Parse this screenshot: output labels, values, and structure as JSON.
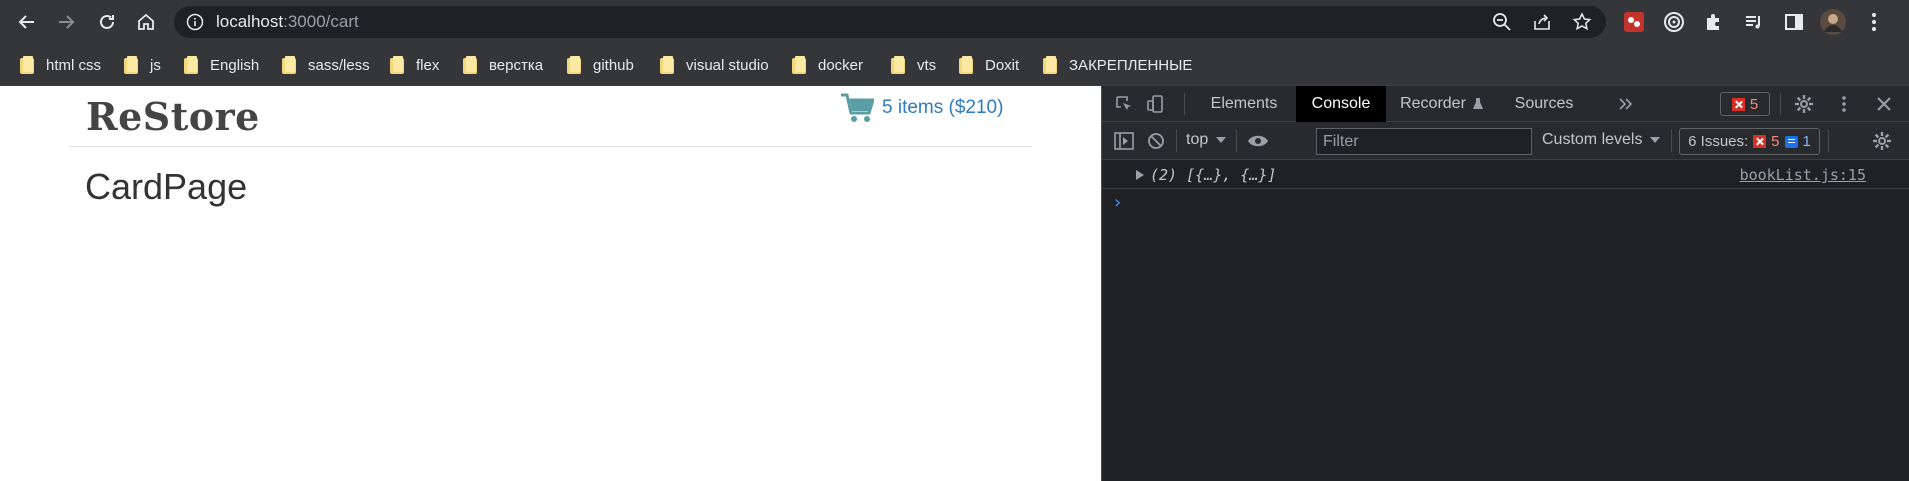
{
  "browser": {
    "url_host": "localhost",
    "url_path": ":3000/cart",
    "bookmarks": [
      {
        "label": "html css"
      },
      {
        "label": "js"
      },
      {
        "label": "English"
      },
      {
        "label": "sass/less"
      },
      {
        "label": "flex"
      },
      {
        "label": "верстка"
      },
      {
        "label": "github"
      },
      {
        "label": "visual studio"
      },
      {
        "label": "docker"
      },
      {
        "label": "vts"
      },
      {
        "label": "Doxit"
      },
      {
        "label": "ЗАКРЕПЛЕННЫЕ"
      }
    ]
  },
  "page": {
    "brand": "ReStore",
    "cart_text": "5 items ($210)",
    "title": "CardPage"
  },
  "devtools": {
    "tabs": [
      "Elements",
      "Console",
      "Recorder",
      "Sources"
    ],
    "active_tab": "Console",
    "error_count": "5",
    "context": "top",
    "filter_placeholder": "Filter",
    "levels": "Custom levels",
    "issues_label": "6 Issues:",
    "issues_errors": "5",
    "issues_info": "1",
    "log_message": "(2) [{…}, {…}]",
    "log_source": "bookList.js:15",
    "prompt": "›"
  },
  "colors": {
    "brand_text": "#444444",
    "cart_link": "#2e7cbf",
    "cart_icon": "#5b9ea6",
    "error_red": "#d93025",
    "info_blue": "#1a73e8"
  }
}
